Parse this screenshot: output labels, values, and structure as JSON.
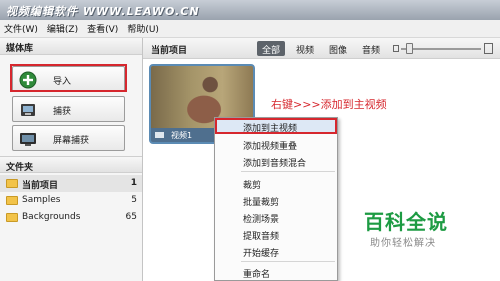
{
  "window": {
    "title": "视频编辑软件 WWW.LEAWO.CN"
  },
  "menu": [
    {
      "label": "文件(W)"
    },
    {
      "label": "编辑(Z)"
    },
    {
      "label": "查看(V)"
    },
    {
      "label": "帮助(U)"
    }
  ],
  "media_library": {
    "header": "媒体库",
    "buttons": [
      {
        "label": "导入",
        "icon": "plus-icon"
      },
      {
        "label": "捕获",
        "icon": "capture-icon"
      },
      {
        "label": "屏幕捕获",
        "icon": "screen-capture-icon"
      }
    ]
  },
  "folders": {
    "header": "文件夹",
    "items": [
      {
        "name": "当前项目",
        "count": "1",
        "selected": true
      },
      {
        "name": "Samples",
        "count": "5"
      },
      {
        "name": "Backgrounds",
        "count": "65"
      }
    ]
  },
  "project": {
    "title": "当前项目",
    "filters": [
      {
        "label": "全部",
        "active": true
      },
      {
        "label": "视频"
      },
      {
        "label": "图像"
      },
      {
        "label": "音频"
      }
    ],
    "clip_name": "视频1"
  },
  "annotation": "右键>>>添加到主视频",
  "context_menu": {
    "items": [
      "添加到主视频",
      "添加视频重叠",
      "添加到音频混合",
      "裁剪",
      "批量裁剪",
      "检测场景",
      "提取音频",
      "开始缓存",
      "重命名"
    ]
  },
  "watermark": {
    "title": "百科全说",
    "subtitle": "助你轻松解决"
  },
  "colors": {
    "highlight_red": "#d6272e",
    "watermark_green": "#1d9b43",
    "active_tab": "#5d636a"
  }
}
